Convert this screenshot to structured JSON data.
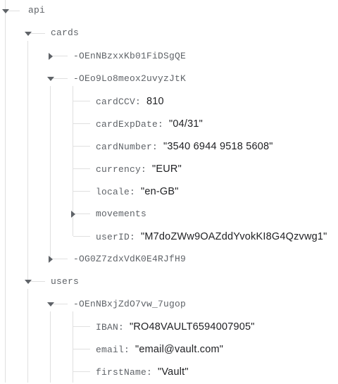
{
  "tree": {
    "root": {
      "key": "api"
    },
    "cards": {
      "key": "cards",
      "card1": {
        "key": "-OEnNBzxxKb01FiDSgQE"
      },
      "card2": {
        "key": "-OEo9Lo8meox2uvyzJtK",
        "fields": {
          "cardCCV": {
            "key": "cardCCV",
            "value": "810"
          },
          "cardExpDate": {
            "key": "cardExpDate",
            "value": "\"04/31\""
          },
          "cardNumber": {
            "key": "cardNumber",
            "value": "\"3540 6944 9518 5608\""
          },
          "currency": {
            "key": "currency",
            "value": "\"EUR\""
          },
          "locale": {
            "key": "locale",
            "value": "\"en-GB\""
          },
          "movements": {
            "key": "movements"
          },
          "userID": {
            "key": "userID",
            "value": "\"M7doZWw9OAZddYvokKI8G4Qzvwg1\""
          }
        }
      },
      "card3": {
        "key": "-OG0Z7zdxVdK0E4RJfH9"
      }
    },
    "users": {
      "key": "users",
      "user1": {
        "key": "-OEnNBxjZdO7vw_7ugop",
        "fields": {
          "IBAN": {
            "key": "IBAN",
            "value": "\"RO48VAULT6594007905\""
          },
          "email": {
            "key": "email",
            "value": "\"email@vault.com\""
          },
          "firstName": {
            "key": "firstName",
            "value": "\"Vault\""
          }
        }
      }
    }
  },
  "colors": {
    "key": "#5f6368",
    "value": "#202124",
    "lines": "#e0e0e0",
    "caret": "#5f6368"
  },
  "icons": {
    "expanded": "caret-down-icon",
    "collapsed": "caret-right-icon"
  }
}
